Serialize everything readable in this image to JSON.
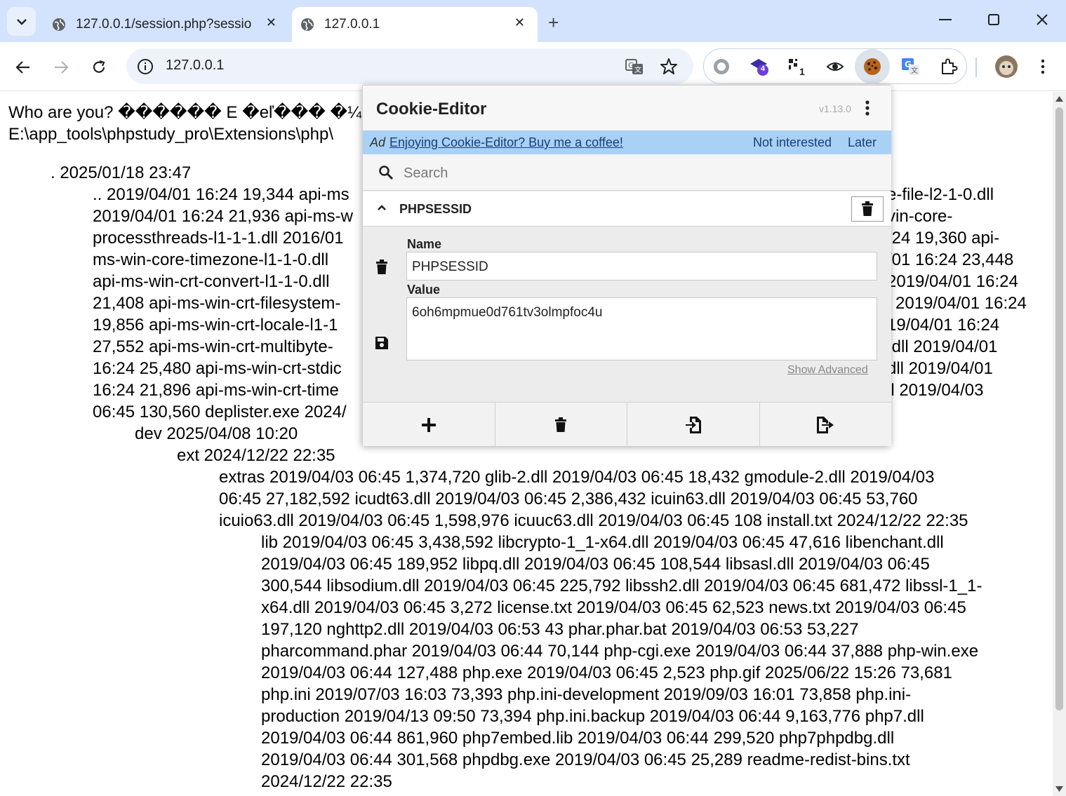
{
  "tabs": [
    {
      "title": "127.0.0.1/session.php?session",
      "active": false
    },
    {
      "title": "127.0.0.1",
      "active": true
    }
  ],
  "toolbar": {
    "url": "127.0.0.1",
    "extension_badges": {
      "graduation": "4",
      "qr": "1"
    }
  },
  "page": {
    "lines": [
      "Who are you? ������ E �eľ��� �¼",
      "E:\\app_tools\\phpstudy_pro\\Extensions\\php\\",
      ". 2025/01/18 23:47",
      ".. 2019/04/01 16:24 19,344 api-ms",
      "2019/04/01 16:24 21,936 api-ms-w",
      "processthreads-l1-1-1.dll 2016/01",
      "ms-win-core-timezone-l1-1-0.dll",
      "api-ms-win-crt-convert-l1-1-0.dll",
      "21,408 api-ms-win-crt-filesystem-",
      "19,856 api-ms-win-crt-locale-l1-1",
      "27,552 api-ms-win-crt-multibyte-",
      "16:24 25,480 api-ms-win-crt-stdic",
      "16:24 21,896 api-ms-win-crt-time",
      "06:45 130,560 deplister.exe 2024/",
      "dev 2025/04/08 10:20",
      "ext 2024/12/22 22:35",
      "extras 2019/04/03 06:45 1,374,720 glib-2.dll 2019/04/03 06:45 18,432 gmodule-2.dll 2019/04/03",
      "06:45 27,182,592 icudt63.dll 2019/04/03 06:45 2,386,432 icuin63.dll 2019/04/03 06:45 53,760",
      "icuio63.dll 2019/04/03 06:45 1,598,976 icuuc63.dll 2019/04/03 06:45 108 install.txt 2024/12/22 22:35",
      "lib 2019/04/03 06:45 3,438,592 libcrypto-1_1-x64.dll 2019/04/03 06:45 47,616 libenchant.dll",
      "2019/04/03 06:45 189,952 libpq.dll 2019/04/03 06:45 108,544 libsasl.dll 2019/04/03 06:45",
      "300,544 libsodium.dll 2019/04/03 06:45 225,792 libssh2.dll 2019/04/03 06:45 681,472 libssl-1_1-",
      "x64.dll 2019/04/03 06:45 3,272 license.txt 2019/04/03 06:45 62,523 news.txt 2019/04/03 06:45",
      "197,120 nghttp2.dll 2019/04/03 06:53 43 phar.phar.bat 2019/04/03 06:53 53,227",
      "pharcommand.phar 2019/04/03 06:44 70,144 php-cgi.exe 2019/04/03 06:44 37,888 php-win.exe",
      "2019/04/03 06:44 127,488 php.exe 2019/04/03 06:45 2,523 php.gif 2025/06/22 15:26 73,681",
      "php.ini 2019/07/03 16:03 73,393 php.ini-development 2019/09/03 16:01 73,858 php.ini-",
      "production 2019/04/13 09:50 73,394 php.ini.backup 2019/04/03 06:44 9,163,776 php7.dll",
      "2019/04/03 06:44 861,960 php7embed.lib 2019/04/03 06:44 299,520 php7phpdbg.dll",
      "2019/04/03 06:44 301,568 phpdbg.exe 2019/04/03 06:45 25,289 readme-redist-bins.txt",
      "2024/12/22 22:35"
    ],
    "right_fragments": [
      "e-file-l2-1-0.dll",
      "vin-core-",
      ":24 19,360 api-",
      "/01 16:24 23,448",
      "2019/04/01 16:24",
      "l 2019/04/01 16:24",
      "19/04/01 16:24",
      ".dll 2019/04/01",
      "dll 2019/04/01",
      "ll 2019/04/03"
    ]
  },
  "cookie_editor": {
    "title": "Cookie-Editor",
    "version": "v1.13.0",
    "ad_tag": "Ad",
    "ad_link": "Enjoying Cookie-Editor? Buy me a coffee!",
    "not_interested": "Not interested",
    "later": "Later",
    "search_placeholder": "Search",
    "cookie_name_header": "PHPSESSID",
    "name_label": "Name",
    "name_value": "PHPSESSID",
    "value_label": "Value",
    "value_value": "6oh6mpmue0d761tv3olmpfoc4u",
    "show_advanced": "Show Advanced"
  }
}
